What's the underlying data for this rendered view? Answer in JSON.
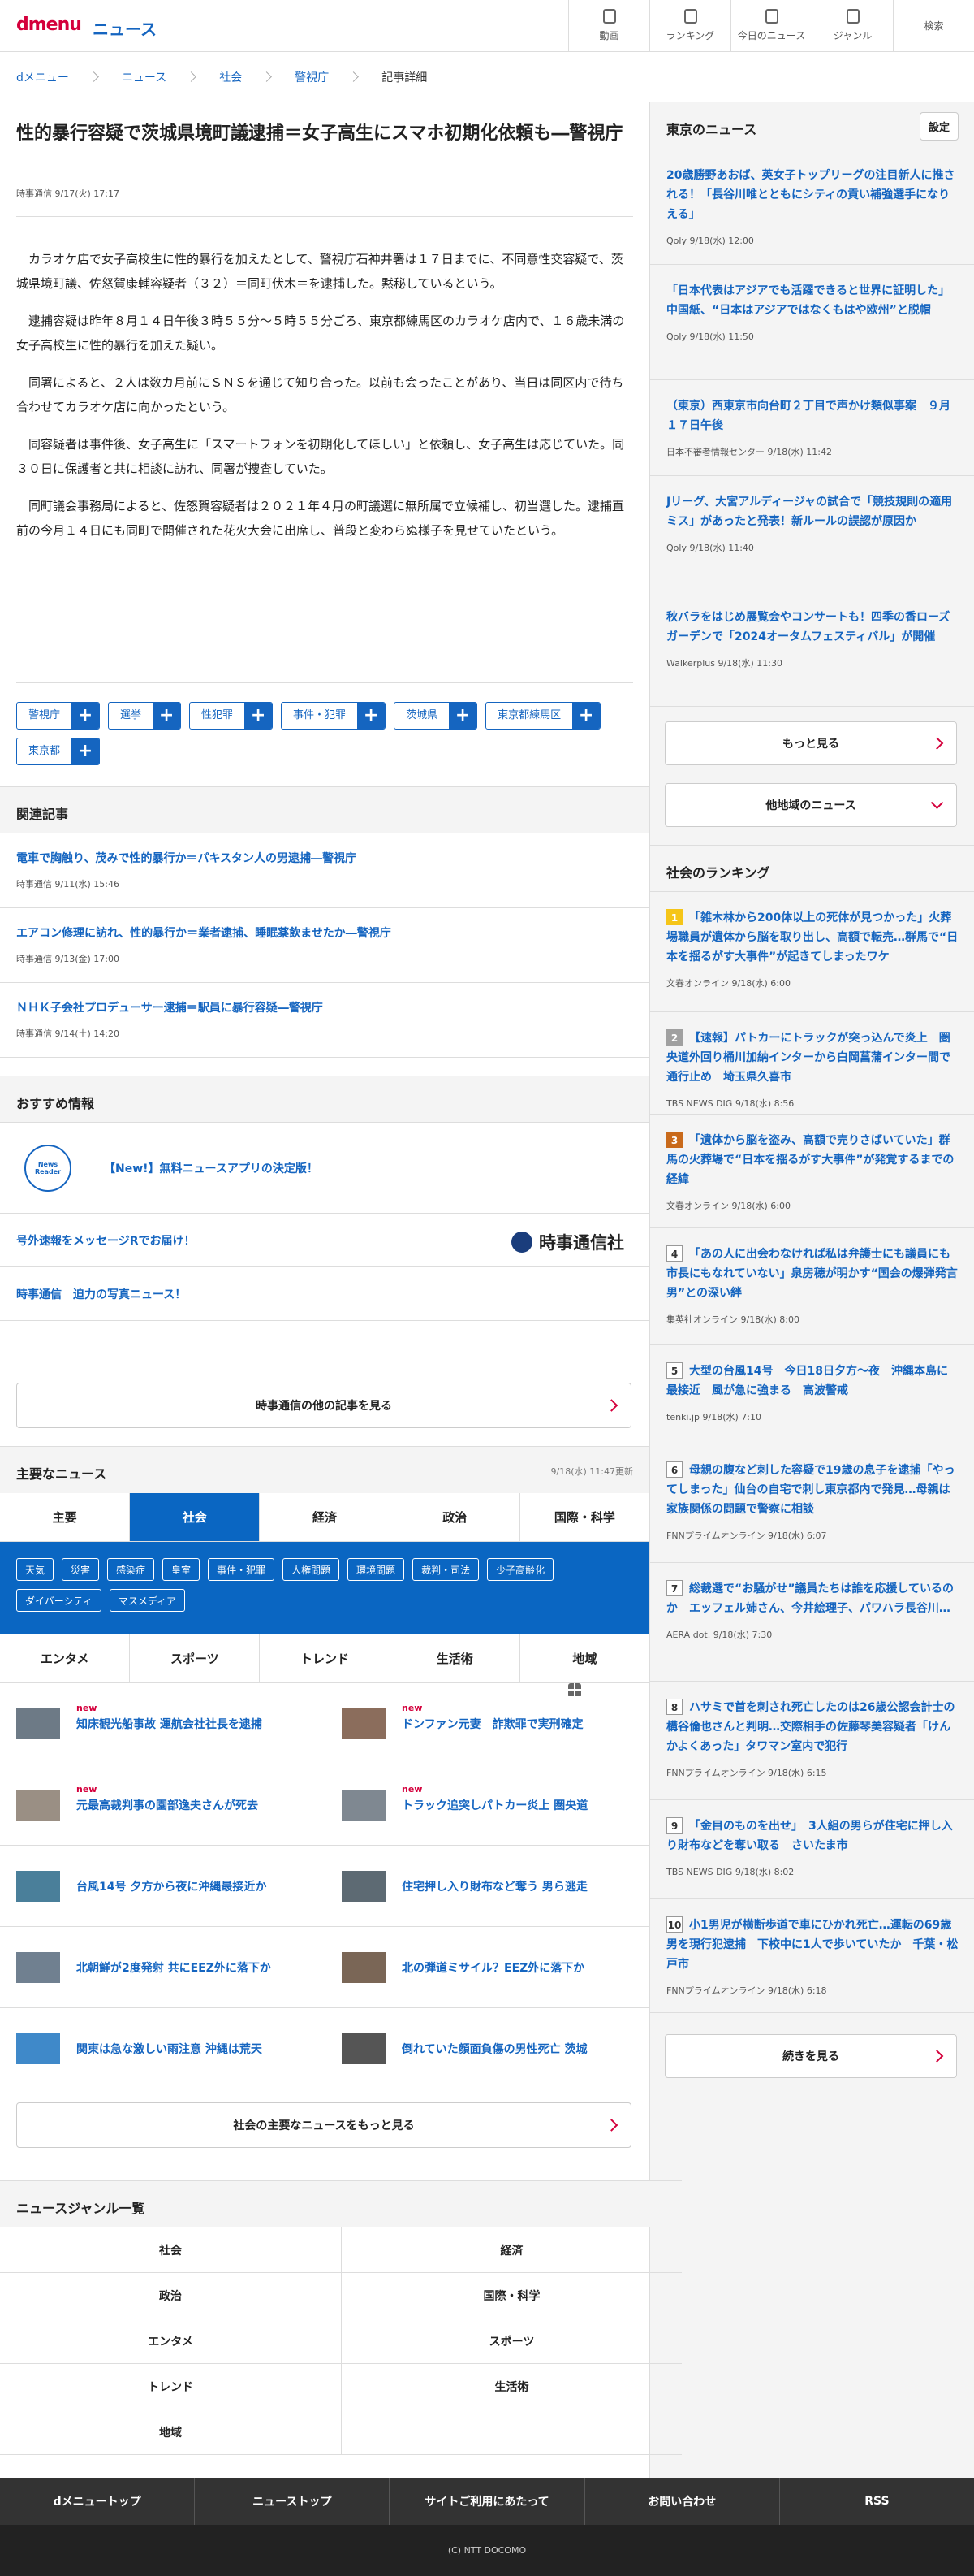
{
  "header": {
    "logo": "dmenu",
    "section": "ニュース",
    "nav": [
      {
        "label": "動画"
      },
      {
        "label": "ランキング"
      },
      {
        "label": "今日のニュース"
      },
      {
        "label": "ジャンル"
      },
      {
        "label": "検索"
      }
    ]
  },
  "breadcrumb": [
    "dメニュー",
    "ニュース",
    "社会",
    "警視庁",
    "記事詳細"
  ],
  "article": {
    "title": "性的暴行容疑で茨城県境町議逮捕＝女子高生にスマホ初期化依頼も―警視庁",
    "source": "時事通信 9/17(火) 17:17",
    "paragraphs": [
      "カラオケ店で女子高校生に性的暴行を加えたとして、警視庁石神井署は１７日までに、不同意性交容疑で、茨城県境町議、佐怒賀康輔容疑者（３２）＝同町伏木＝を逮捕した。黙秘しているという。",
      "逮捕容疑は昨年８月１４日午後３時５５分～５時５５分ごろ、東京都練馬区のカラオケ店内で、１６歳未満の女子高校生に性的暴行を加えた疑い。",
      "同署によると、２人は数カ月前にＳＮＳを通じて知り合った。以前も会ったことがあり、当日は同区内で待ち合わせてカラオケ店に向かったという。",
      "同容疑者は事件後、女子高生に「スマートフォンを初期化してほしい」と依頼し、女子高生は応じていた。同３０日に保護者と共に相談に訪れ、同署が捜査していた。",
      "同町議会事務局によると、佐怒賀容疑者は２０２１年４月の町議選に無所属で立候補し、初当選した。逮捕直前の今月１４日にも同町で開催された花火大会に出席し、普段と変わらぬ様子を見せていたという。"
    ],
    "tags": [
      "警視庁",
      "選挙",
      "性犯罪",
      "事件・犯罪",
      "茨城県",
      "東京都練馬区",
      "東京都"
    ]
  },
  "related": {
    "heading": "関連記事",
    "items": [
      {
        "title": "電車で胸触り、茂みで性的暴行か＝パキスタン人の男逮捕―警視庁",
        "meta": "時事通信 9/11(水) 15:46"
      },
      {
        "title": "エアコン修理に訪れ、性的暴行か＝業者逮捕、睡眠薬飲ませたか―警視庁",
        "meta": "時事通信 9/13(金) 17:00"
      },
      {
        "title": "ＮＨＫ子会社プロデューサー逮捕＝駅員に暴行容疑―警視庁",
        "meta": "時事通信 9/14(土) 14:20"
      }
    ]
  },
  "recommend": {
    "heading": "おすすめ情報",
    "app_icon_text": "News Reader",
    "items": [
      "【New!】無料ニュースアプリの決定版！",
      "号外速報をメッセージRでお届け！",
      "時事通信　迫力の写真ニュース！"
    ],
    "provider": "時事通信社",
    "more": "時事通信の他の記事を見る"
  },
  "topnews": {
    "heading": "主要なニュース",
    "updated": "9/18(水) 11:47更新",
    "tabs1": [
      "主要",
      "社会",
      "経済",
      "政治",
      "国際・科学"
    ],
    "active_tab": "社会",
    "subtags": [
      "天気",
      "災害",
      "感染症",
      "皇室",
      "事件・犯罪",
      "人権問題",
      "環境問題",
      "裁判・司法",
      "少子高齢化",
      "ダイバーシティ",
      "マスメディア"
    ],
    "tabs2": [
      "エンタメ",
      "スポーツ",
      "トレンド",
      "生活術",
      "地域"
    ],
    "new_label": "new",
    "items": [
      {
        "title": "知床観光船事故 運航会社社長を逮捕",
        "new": true
      },
      {
        "title": "ドンファン元妻　詐欺罪で実刑確定",
        "new": true
      },
      {
        "title": "元最高裁判事の園部逸夫さんが死去",
        "new": true
      },
      {
        "title": "トラック追突しパトカー炎上 圏央道",
        "new": true
      },
      {
        "title": "台風14号 夕方から夜に沖縄最接近か",
        "new": false
      },
      {
        "title": "住宅押し入り財布など奪う 男ら逃走",
        "new": false
      },
      {
        "title": "北朝鮮が2度発射 共にEEZ外に落下か",
        "new": false
      },
      {
        "title": "北の弾道ミサイル？EEZ外に落下か",
        "new": false
      },
      {
        "title": "関東は急な激しい雨注意 沖縄は荒天",
        "new": false
      },
      {
        "title": "倒れていた顔面負傷の男性死亡 茨城",
        "new": false
      }
    ],
    "more": "社会の主要なニュースをもっと見る"
  },
  "tokyo": {
    "heading": "東京のニュース",
    "settings": "設定",
    "items": [
      {
        "title": "20歳勝野あおば、英女子トップリーグの注目新人に推される！「長谷川唯とともにシティの貢い補強選手になりえる」",
        "meta": "Qoly 9/18(水) 12:00"
      },
      {
        "title": "「日本代表はアジアでも活躍できると世界に証明した」中国紙、“日本はアジアではなくもはや欧州”と脱帽",
        "meta": "Qoly 9/18(水) 11:50"
      },
      {
        "title": "（東京）西東京市向台町２丁目で声かけ類似事案　９月１７日午後",
        "meta": "日本不審者情報センター 9/18(水) 11:42"
      },
      {
        "title": "Jリーグ、大宮アルディージャの試合で「競技規則の適用ミス」があったと発表！新ルールの誤認が原因か",
        "meta": "Qoly 9/18(水) 11:40"
      },
      {
        "title": "秋バラをはじめ展覧会やコンサートも！四季の香ローズガーデンで「2024オータムフェスティバル」が開催",
        "meta": "Walkerplus 9/18(水) 11:30"
      }
    ],
    "more": "もっと見る",
    "other": "他地域のニュース"
  },
  "ranking": {
    "heading": "社会のランキング",
    "items": [
      {
        "rank": "1",
        "title": "「雑木林から200体以上の死体が見つかった」火葬場職員が遺体から脳を取り出し、高額で転売…群馬で“日本を揺るがす大事件”が起きてしまったワケ",
        "meta": "文春オンライン 9/18(水) 6:00"
      },
      {
        "rank": "2",
        "title": "【速報】パトカーにトラックが突っ込んで炎上　圏央道外回り桶川加納インターから白岡菖蒲インター間で通行止め　埼玉県久喜市",
        "meta": "TBS NEWS DIG 9/18(水) 8:56"
      },
      {
        "rank": "3",
        "title": "「遺体から脳を盗み、高額で売りさばいていた」群馬の火葬場で“日本を揺るがす大事件”が発覚するまでの経緯",
        "meta": "文春オンライン 9/18(水) 6:00"
      },
      {
        "rank": "4",
        "title": "「あの人に出会わなければ私は弁護士にも議員にも市長にもなれていない」泉房穂が明かす“国会の爆弾発言男”との深い絆",
        "meta": "集英社オンライン 9/18(水) 8:00"
      },
      {
        "rank": "5",
        "title": "大型の台風14号　今日18日夕方～夜　沖縄本島に最接近　風が急に強まる　高波警戒",
        "meta": "tenki.jp 9/18(水) 7:10"
      },
      {
        "rank": "6",
        "title": "母親の腹など刺した容疑で19歳の息子を逮捕「やってしまった」仙台の自宅で刺し東京都内で発見…母親は家族関係の問題で警察に相談",
        "meta": "FNNプライムオンライン 9/18(水) 6:07"
      },
      {
        "rank": "7",
        "title": "総裁選で“お騒がせ”議員たちは誰を応援しているのか　エッフェル姉さん、今井絵理子、パワハラ長谷川…",
        "meta": "AERA dot. 9/18(水) 7:30"
      },
      {
        "rank": "8",
        "title": "ハサミで首を刺され死亡したのは26歳公認会計士の構谷倫也さんと判明…交際相手の佐藤琴美容疑者「けんかよくあった」タワマン室内で犯行",
        "meta": "FNNプライムオンライン 9/18(水) 6:15"
      },
      {
        "rank": "9",
        "title": "「金目のものを出せ」　3人組の男らが住宅に押し入り財布などを奪い取る　さいたま市",
        "meta": "TBS NEWS DIG 9/18(水) 8:02"
      },
      {
        "rank": "10",
        "title": "小1男児が横断歩道で車にひかれ死亡…運転の69歳男を現行犯逮捕　下校中に1人で歩いていたか　千葉・松戸市",
        "meta": "FNNプライムオンライン 9/18(水) 6:18"
      }
    ],
    "more": "続きを見る"
  },
  "genres": {
    "heading": "ニュースジャンル一覧",
    "items": [
      "社会",
      "経済",
      "政治",
      "国際・科学",
      "エンタメ",
      "スポーツ",
      "トレンド",
      "生活術",
      "地域"
    ]
  },
  "footer": {
    "nav": [
      "dメニュートップ",
      "ニューストップ",
      "サイトご利用にあたって",
      "お問い合わせ",
      "RSS"
    ],
    "copyright": "(C) NTT DOCOMO"
  },
  "colors": {
    "brand": "#d4003c",
    "link": "#1565c0",
    "tab_active": "#0a66c2"
  }
}
